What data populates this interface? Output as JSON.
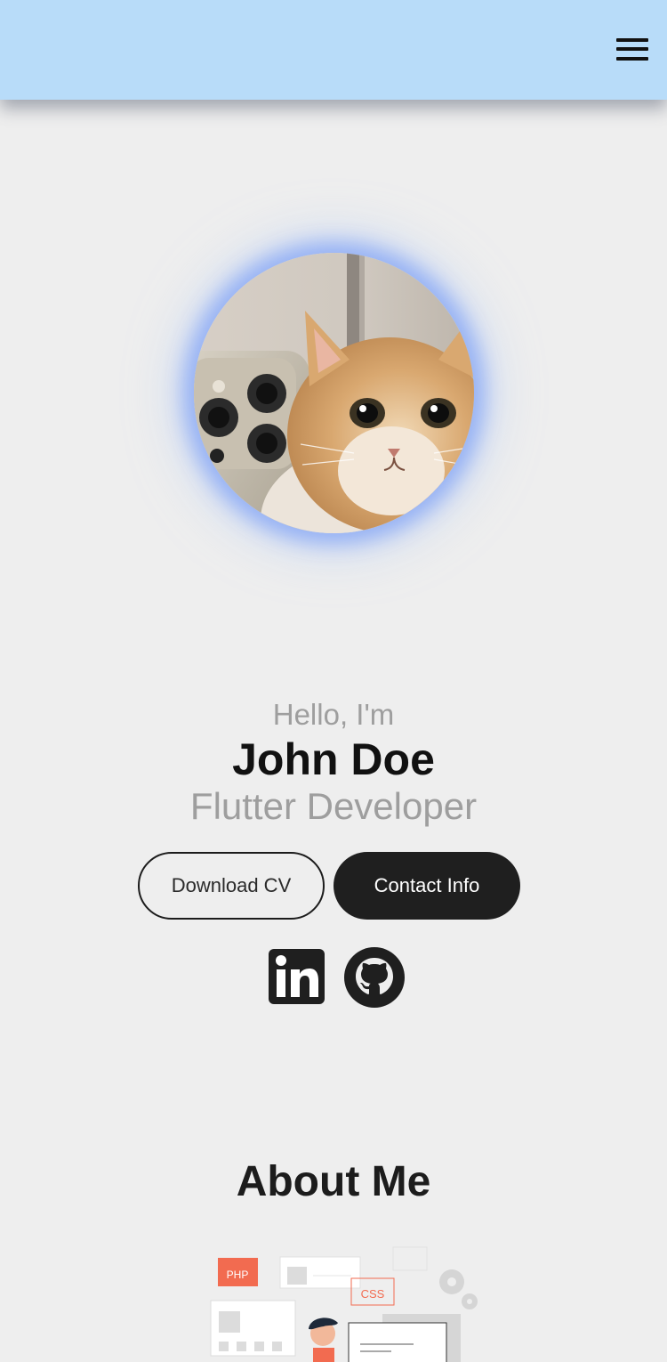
{
  "header": {
    "menu_icon": "hamburger-menu-icon",
    "background_color": "#b8dcf9"
  },
  "profile": {
    "avatar_description_icon": "profile-photo",
    "glow_color": "#8caaf5"
  },
  "hero": {
    "greeting": "Hello, I'm",
    "name": "John Doe",
    "role": "Flutter Developer"
  },
  "buttons": {
    "download_cv": "Download CV",
    "contact_info": "Contact Info"
  },
  "social": {
    "icons": [
      "linkedin-icon",
      "github-icon"
    ]
  },
  "about": {
    "title": "About Me",
    "illustration": {
      "labels": [
        "PHP",
        "CSS"
      ]
    }
  },
  "colors": {
    "background": "#eeeeee",
    "primary_dark": "#1f1f1f",
    "muted_text": "#9e9e9e",
    "accent_orange": "#f26b50"
  }
}
